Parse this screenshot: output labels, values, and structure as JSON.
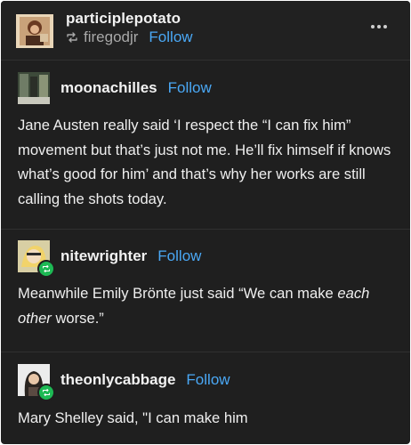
{
  "post": {
    "author": "participlepotato",
    "reblogged_from": "firegodjr",
    "follow_label": "Follow"
  },
  "thread": [
    {
      "username": "moonachilles",
      "follow_label": "Follow",
      "text": "Jane Austen really said ‘I respect the “I can fix him” movement but that’s just not me. He’ll fix himself if knows what’s good for him’ and that’s why her works are still calling the shots today."
    },
    {
      "username": "nitewrighter",
      "follow_label": "Follow",
      "text_before": "Meanwhile Emily Brönte just said “We can make ",
      "text_emphasis": "each other",
      "text_after": " worse.”"
    },
    {
      "username": "theonlycabbage",
      "follow_label": "Follow",
      "text": "Mary Shelley said, \"I can make him"
    }
  ],
  "icons": {
    "reblog": "reblog-icon",
    "more": "more-options-icon",
    "badge": "reblog-badge-icon"
  },
  "colors": {
    "background": "#1f1f1f",
    "text": "#efefef",
    "link": "#4aa8f5",
    "muted": "#a8a8a8",
    "badge": "#1db954"
  }
}
